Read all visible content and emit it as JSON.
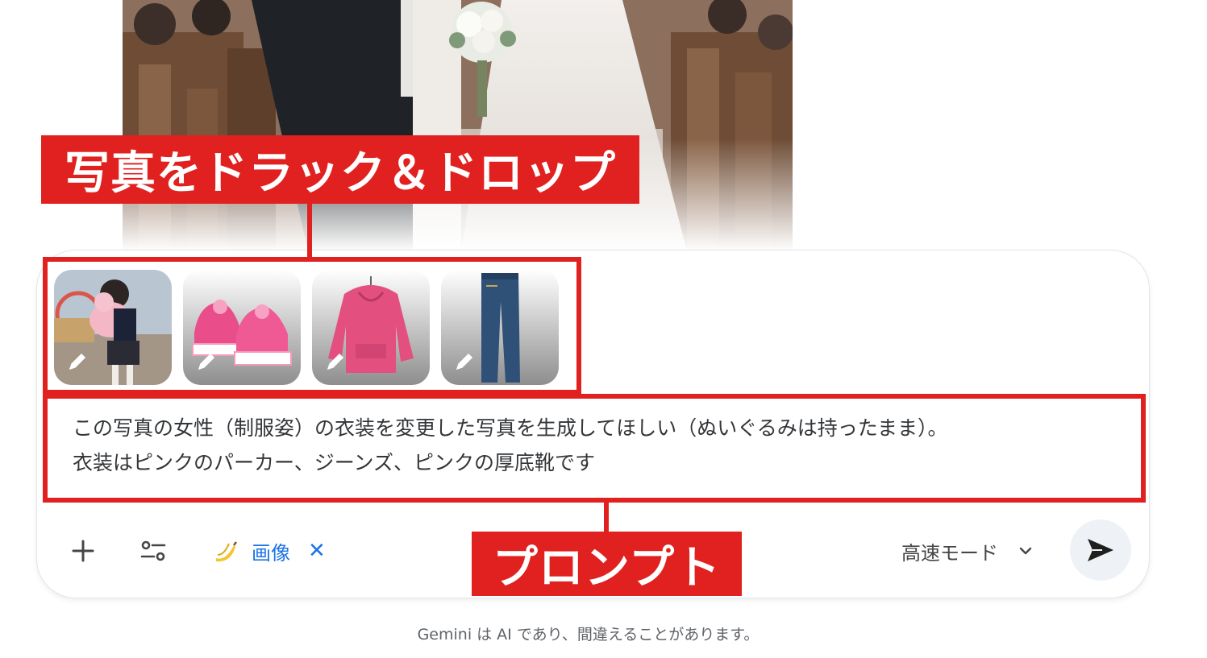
{
  "annotations": {
    "drag_drop_label": "写真をドラック＆ドロップ",
    "prompt_label": "プロンプト"
  },
  "attachments": [
    {
      "icon": "pencil-icon",
      "subject": "girl-with-plush"
    },
    {
      "icon": "pencil-icon",
      "subject": "pink-sneakers"
    },
    {
      "icon": "pencil-icon",
      "subject": "pink-hoodie"
    },
    {
      "icon": "pencil-icon",
      "subject": "jeans"
    }
  ],
  "prompt": {
    "line1": "この写真の女性（制服姿）の衣装を変更した写真を生成してほしい（ぬいぐるみは持ったまま）。",
    "line2": "衣装はピンクのパーカー、ジーンズ、ピンクの厚底靴です"
  },
  "toolbar": {
    "add_icon": "plus-icon",
    "tools_icon": "tools-icon",
    "chip_icon": "banana-icon",
    "chip_label": "画像",
    "chip_close": "✕",
    "mode_label": "高速モード",
    "mode_icon": "chevron-down-icon",
    "send_icon": "send-icon"
  },
  "footer": {
    "disclaimer": "Gemini は AI であり、間違えることがあります。"
  },
  "colors": {
    "annotation_red": "#e1211f",
    "accent_blue": "#1a73e8",
    "send_bg": "#eef1f6"
  }
}
